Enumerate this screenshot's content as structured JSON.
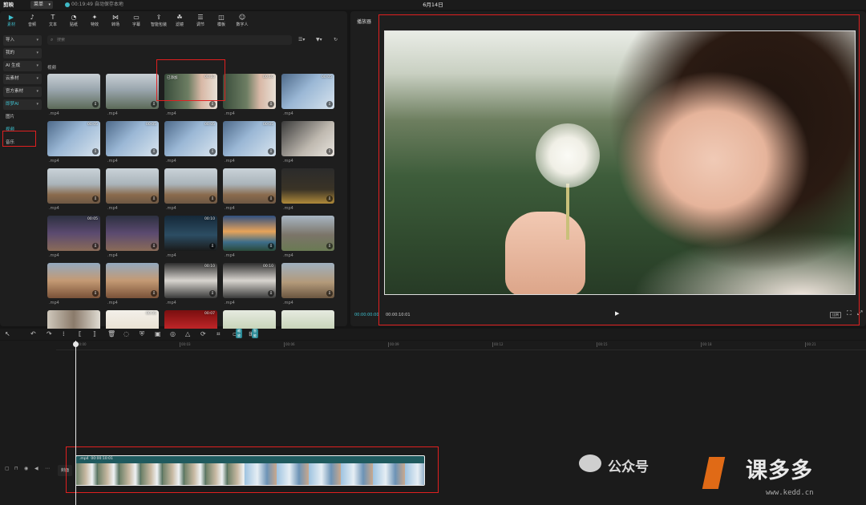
{
  "app": {
    "name": "剪映",
    "menu_label": "菜单",
    "autosave": "00:19:49 自动保存本地",
    "project_title": "6月14日"
  },
  "toolbar": [
    {
      "label": "素材",
      "icon": "media-icon"
    },
    {
      "label": "音频",
      "icon": "audio-icon"
    },
    {
      "label": "文本",
      "icon": "text-icon"
    },
    {
      "label": "贴纸",
      "icon": "sticker-icon"
    },
    {
      "label": "特效",
      "icon": "effects-icon"
    },
    {
      "label": "转场",
      "icon": "transition-icon"
    },
    {
      "label": "字幕",
      "icon": "caption-icon"
    },
    {
      "label": "智能包装",
      "icon": "smart-pack-icon"
    },
    {
      "label": "滤镜",
      "icon": "filter-icon"
    },
    {
      "label": "调节",
      "icon": "adjust-icon"
    },
    {
      "label": "模板",
      "icon": "template-icon"
    },
    {
      "label": "数字人",
      "icon": "digital-human-icon"
    }
  ],
  "sidebar": [
    {
      "label": "导入"
    },
    {
      "label": "我的"
    },
    {
      "label": "AI 生成"
    },
    {
      "label": "云素材"
    },
    {
      "label": "官方素材"
    },
    {
      "label": "即梦AI"
    },
    {
      "label": "图片"
    },
    {
      "label": "视频"
    },
    {
      "label": "音乐"
    }
  ],
  "search": {
    "placeholder": "搜索"
  },
  "section_title": "视频",
  "media": [
    {
      "dur": "",
      "cap": ".mp4",
      "theme": "t-boy"
    },
    {
      "dur": "",
      "cap": ".mp4",
      "theme": "t-boy"
    },
    {
      "dur": "00:10",
      "cap": ".mp4",
      "theme": "t-girl",
      "added": "已添加"
    },
    {
      "dur": "00:10",
      "cap": ".mp4",
      "theme": "t-girl"
    },
    {
      "dur": "00:05",
      "cap": ".mp4",
      "theme": "t-robot"
    },
    {
      "dur": "00:05",
      "cap": ".mp4",
      "theme": "t-robot"
    },
    {
      "dur": "00:05",
      "cap": ".mp4",
      "theme": "t-robot"
    },
    {
      "dur": "00:05",
      "cap": ".mp4",
      "theme": "t-robot"
    },
    {
      "dur": "00:05",
      "cap": ".mp4",
      "theme": "t-robot"
    },
    {
      "dur": "",
      "cap": ".mp4",
      "theme": "t-cat"
    },
    {
      "dur": "",
      "cap": ".mp4",
      "theme": "t-plane"
    },
    {
      "dur": "",
      "cap": ".mp4",
      "theme": "t-plane"
    },
    {
      "dur": "",
      "cap": ".mp4",
      "theme": "t-plane"
    },
    {
      "dur": "",
      "cap": ".mp4",
      "theme": "t-plane"
    },
    {
      "dur": "",
      "cap": ".mp4",
      "theme": "t-statue"
    },
    {
      "dur": "00:05",
      "cap": ".mp4",
      "theme": "t-fairy"
    },
    {
      "dur": "",
      "cap": ".mp4",
      "theme": "t-fairy"
    },
    {
      "dur": "00:10",
      "cap": ".mp4",
      "theme": "t-night"
    },
    {
      "dur": "",
      "cap": ".mp4",
      "theme": "t-sunset"
    },
    {
      "dur": "",
      "cap": ".mp4",
      "theme": "t-castle"
    },
    {
      "dur": "",
      "cap": ".mp4",
      "theme": "t-canyon"
    },
    {
      "dur": "",
      "cap": ".mp4",
      "theme": "t-canyon"
    },
    {
      "dur": "00:10",
      "cap": ".mp4",
      "theme": "t-woman"
    },
    {
      "dur": "00:10",
      "cap": ".mp4",
      "theme": "t-woman"
    },
    {
      "dur": "",
      "cap": ".mp4",
      "theme": "t-cowboy"
    },
    {
      "dur": "",
      "cap": "",
      "theme": "t-cafe"
    },
    {
      "dur": "00:05",
      "cap": "",
      "theme": "t-poster"
    },
    {
      "dur": "00:07",
      "cap": "",
      "theme": "t-red"
    },
    {
      "dur": "",
      "cap": "",
      "theme": "t-garden"
    },
    {
      "dur": "",
      "cap": "",
      "theme": "t-garden"
    }
  ],
  "player": {
    "title": "播放器",
    "current_time": "00:00:00:00",
    "total_time": "00:00:10:01",
    "ratio_label": "比例"
  },
  "timeline": {
    "ruler": [
      "00:00",
      "00:03",
      "00:06",
      "00:09",
      "00:12",
      "00:15",
      "00:18",
      "00:21"
    ],
    "badges": [
      "缩放",
      "智能"
    ],
    "cover_label": "封面",
    "clip_name": ".mp4",
    "clip_duration": "00:00:10:01"
  },
  "watermark": {
    "wechat": "公众号",
    "brand": "课多多",
    "url": "www.kedd.cn"
  },
  "colors": {
    "accent": "#3fc0cf",
    "highlight": "#e02020",
    "clip": "#1f5a5e"
  }
}
